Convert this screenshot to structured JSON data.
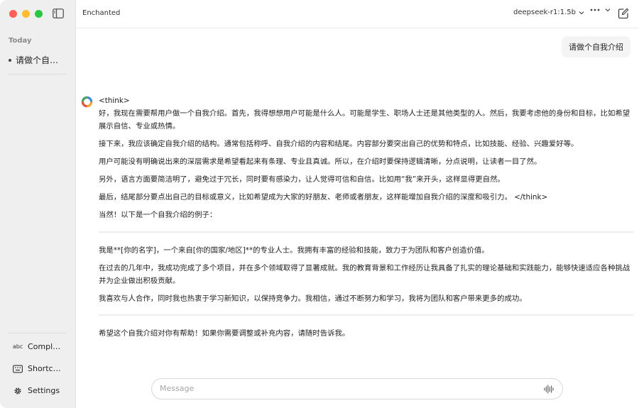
{
  "app": {
    "title": "Enchanted"
  },
  "sidebar": {
    "section_label": "Today",
    "chats": [
      {
        "label": "请做个自…"
      }
    ],
    "bottom_items": [
      {
        "label": "Compl…",
        "icon": "abc-icon"
      },
      {
        "label": "Shortc…",
        "icon": "keyboard-icon"
      },
      {
        "label": "Settings",
        "icon": "gear-icon"
      }
    ]
  },
  "header": {
    "model": "deepseek-r1:1.5b",
    "more_icon": "ellipsis-icon",
    "compose_icon": "compose-icon"
  },
  "conversation": {
    "user_message": "请做个自我介绍",
    "assistant": {
      "p1": "<think>",
      "p2": "好，我现在需要帮用户做一个自我介绍。首先，我得想想用户可能是什么人。可能是学生、职场人士还是其他类型的人。然后，我要考虑他的身份和目标，比如希望展示自信、专业或热情。",
      "p3": "接下来，我应该确定自我介绍的结构。通常包括称呼、自我介绍的内容和结尾。内容部分要突出自己的优势和特点，比如技能、经验、兴趣爱好等。",
      "p4": "用户可能没有明确说出来的深层需求是希望看起来有条理、专业且真诚。所以，在介绍时要保持逻辑清晰，分点说明，让读者一目了然。",
      "p5": "另外，语言方面要简洁明了，避免过于冗长，同时要有感染力，让人觉得可信和自信。比如用“我”来开头，这样显得更自然。",
      "p6": "最后，结尾部分要点出自己的目标或意义，比如希望成为大家的好朋友、老师或者朋友，这样能增加自我介绍的深度和吸引力。 </think>",
      "p7": "当然！以下是一个自我介绍的例子：",
      "p8": "我是**[你的名字]，一个来自[你的国家/地区]**的专业人士。我拥有丰富的经验和技能，致力于为团队和客户创造价值。",
      "p9": "在过去的几年中，我成功完成了多个项目，并在多个领域取得了显著成就。我的教育背景和工作经历让我具备了扎实的理论基础和实践能力，能够快速适应各种挑战并为企业做出积极贡献。",
      "p10": "我喜欢与人合作，同时我也热衷于学习新知识，以保持竞争力。我相信，通过不断努力和学习，我将为团队和客户带来更多的成功。",
      "p11": "希望这个自我介绍对你有帮助！如果你需要调整或补充内容，请随时告诉我。"
    }
  },
  "composer": {
    "placeholder": "Message",
    "mic_icon": "waveform-icon"
  }
}
